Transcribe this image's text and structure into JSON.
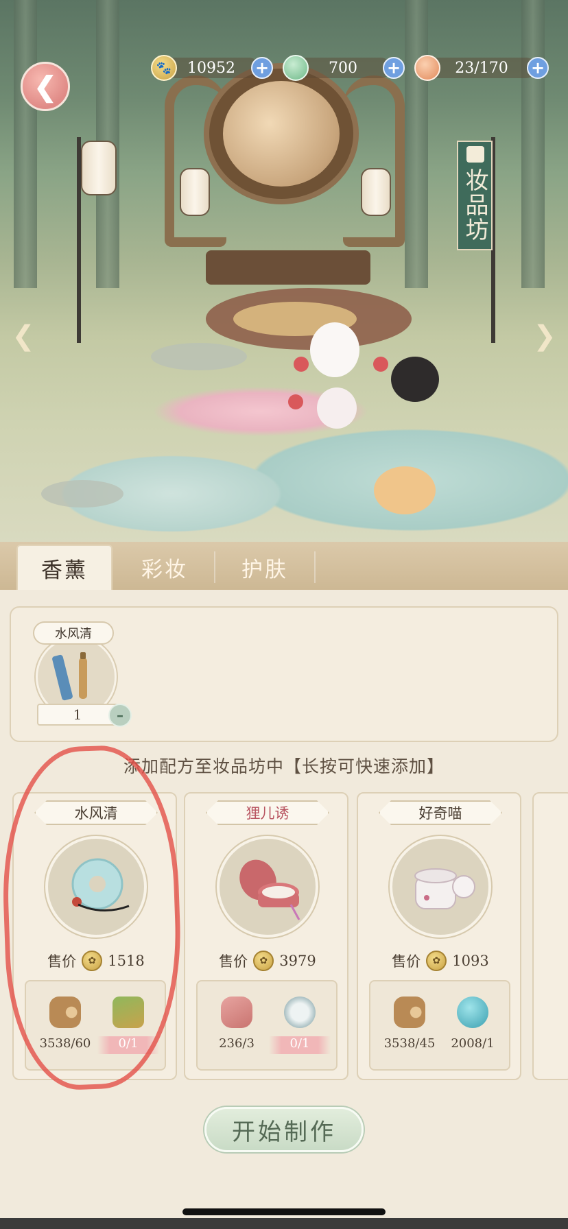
{
  "resources": [
    {
      "icon": "paw-coin-icon",
      "value": "10952"
    },
    {
      "icon": "jade-icon",
      "value": "700"
    },
    {
      "icon": "energy-bun-icon",
      "value": "23/170"
    }
  ],
  "banner": {
    "text": "妆品坊"
  },
  "tabs": [
    {
      "label": "香薰",
      "active": true
    },
    {
      "label": "彩妆",
      "active": false
    },
    {
      "label": "护肤",
      "active": false
    }
  ],
  "slot": {
    "name": "水风清",
    "quantity": "1"
  },
  "hint": "添加配方至妆品坊中【长按可快速添加】",
  "price_label": "售价",
  "recipes": [
    {
      "name": "水风清",
      "price": "1518",
      "special": false,
      "materials": [
        {
          "icon": "wood-log-icon",
          "count": "3538/60",
          "lack": false
        },
        {
          "icon": "bamboo-scroll-icon",
          "count": "0/1",
          "lack": true
        }
      ]
    },
    {
      "name": "狸儿诱",
      "price": "3979",
      "special": true,
      "materials": [
        {
          "icon": "silk-roll-icon",
          "count": "236/3",
          "lack": false
        },
        {
          "icon": "porcelain-dish-icon",
          "count": "0/1",
          "lack": true
        }
      ]
    },
    {
      "name": "好奇喵",
      "price": "1093",
      "special": false,
      "materials": [
        {
          "icon": "wood-log-icon",
          "count": "3538/45",
          "lack": false
        },
        {
          "icon": "blue-gem-icon",
          "count": "2008/1",
          "lack": false
        }
      ]
    }
  ],
  "start_button": "开始制作",
  "colors": {
    "accent_green": "#3f6b5b",
    "lack_pink": "#f1b7b8",
    "plus_blue": "#6f9fe0",
    "annotation_red": "#e45048"
  }
}
